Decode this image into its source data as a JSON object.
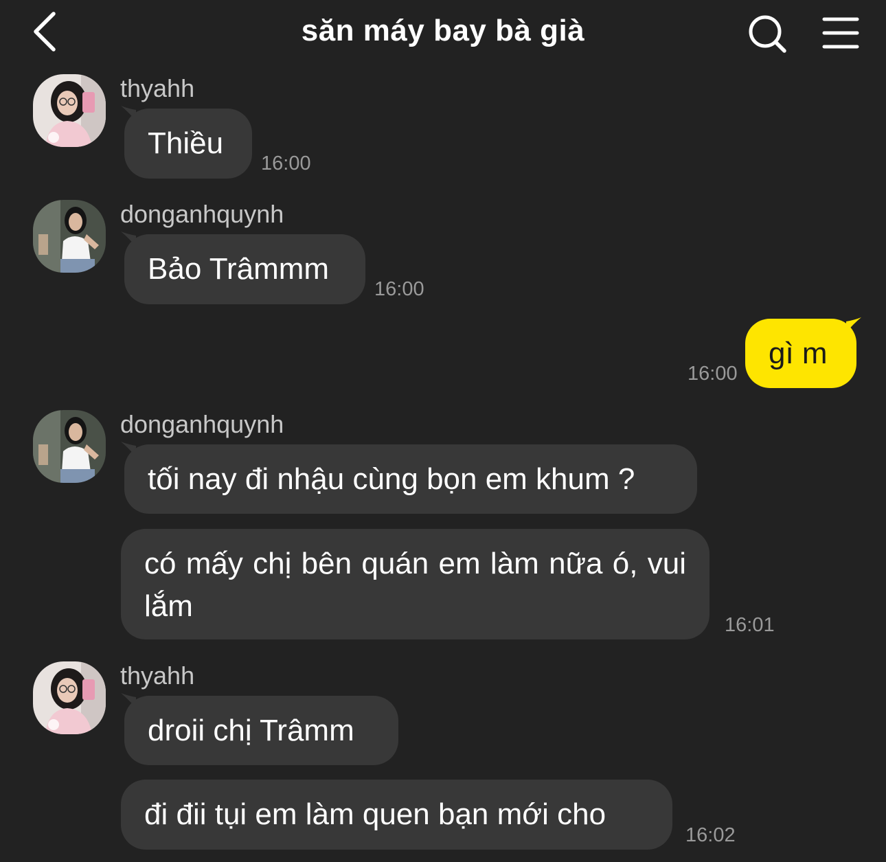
{
  "header": {
    "title": "săn máy bay bà già",
    "back_icon": "chevron-left-icon",
    "search_icon": "search-icon",
    "menu_icon": "menu-icon"
  },
  "colors": {
    "background": "#222222",
    "bubble_other": "#383838",
    "bubble_mine": "#fee500",
    "time_text": "#9a9a9a"
  },
  "messages": [
    {
      "sender": "thyahh",
      "text": "Thiều",
      "time": "16:00"
    },
    {
      "sender": "donganhquynh",
      "text": "Bảo Trâmmm",
      "time": "16:00"
    },
    {
      "sender": "me",
      "text": "gì m",
      "time": "16:00"
    },
    {
      "sender": "donganhquynh",
      "text": "tối nay đi nhậu cùng bọn em khum ?"
    },
    {
      "text": "có mấy chị bên quán em làm nữa ó, vui lắm",
      "time": "16:01"
    },
    {
      "sender": "thyahh",
      "text": "droii chị Trâmm"
    },
    {
      "text": "đi đii tụi em làm quen bạn mới cho",
      "time": "16:02"
    }
  ]
}
